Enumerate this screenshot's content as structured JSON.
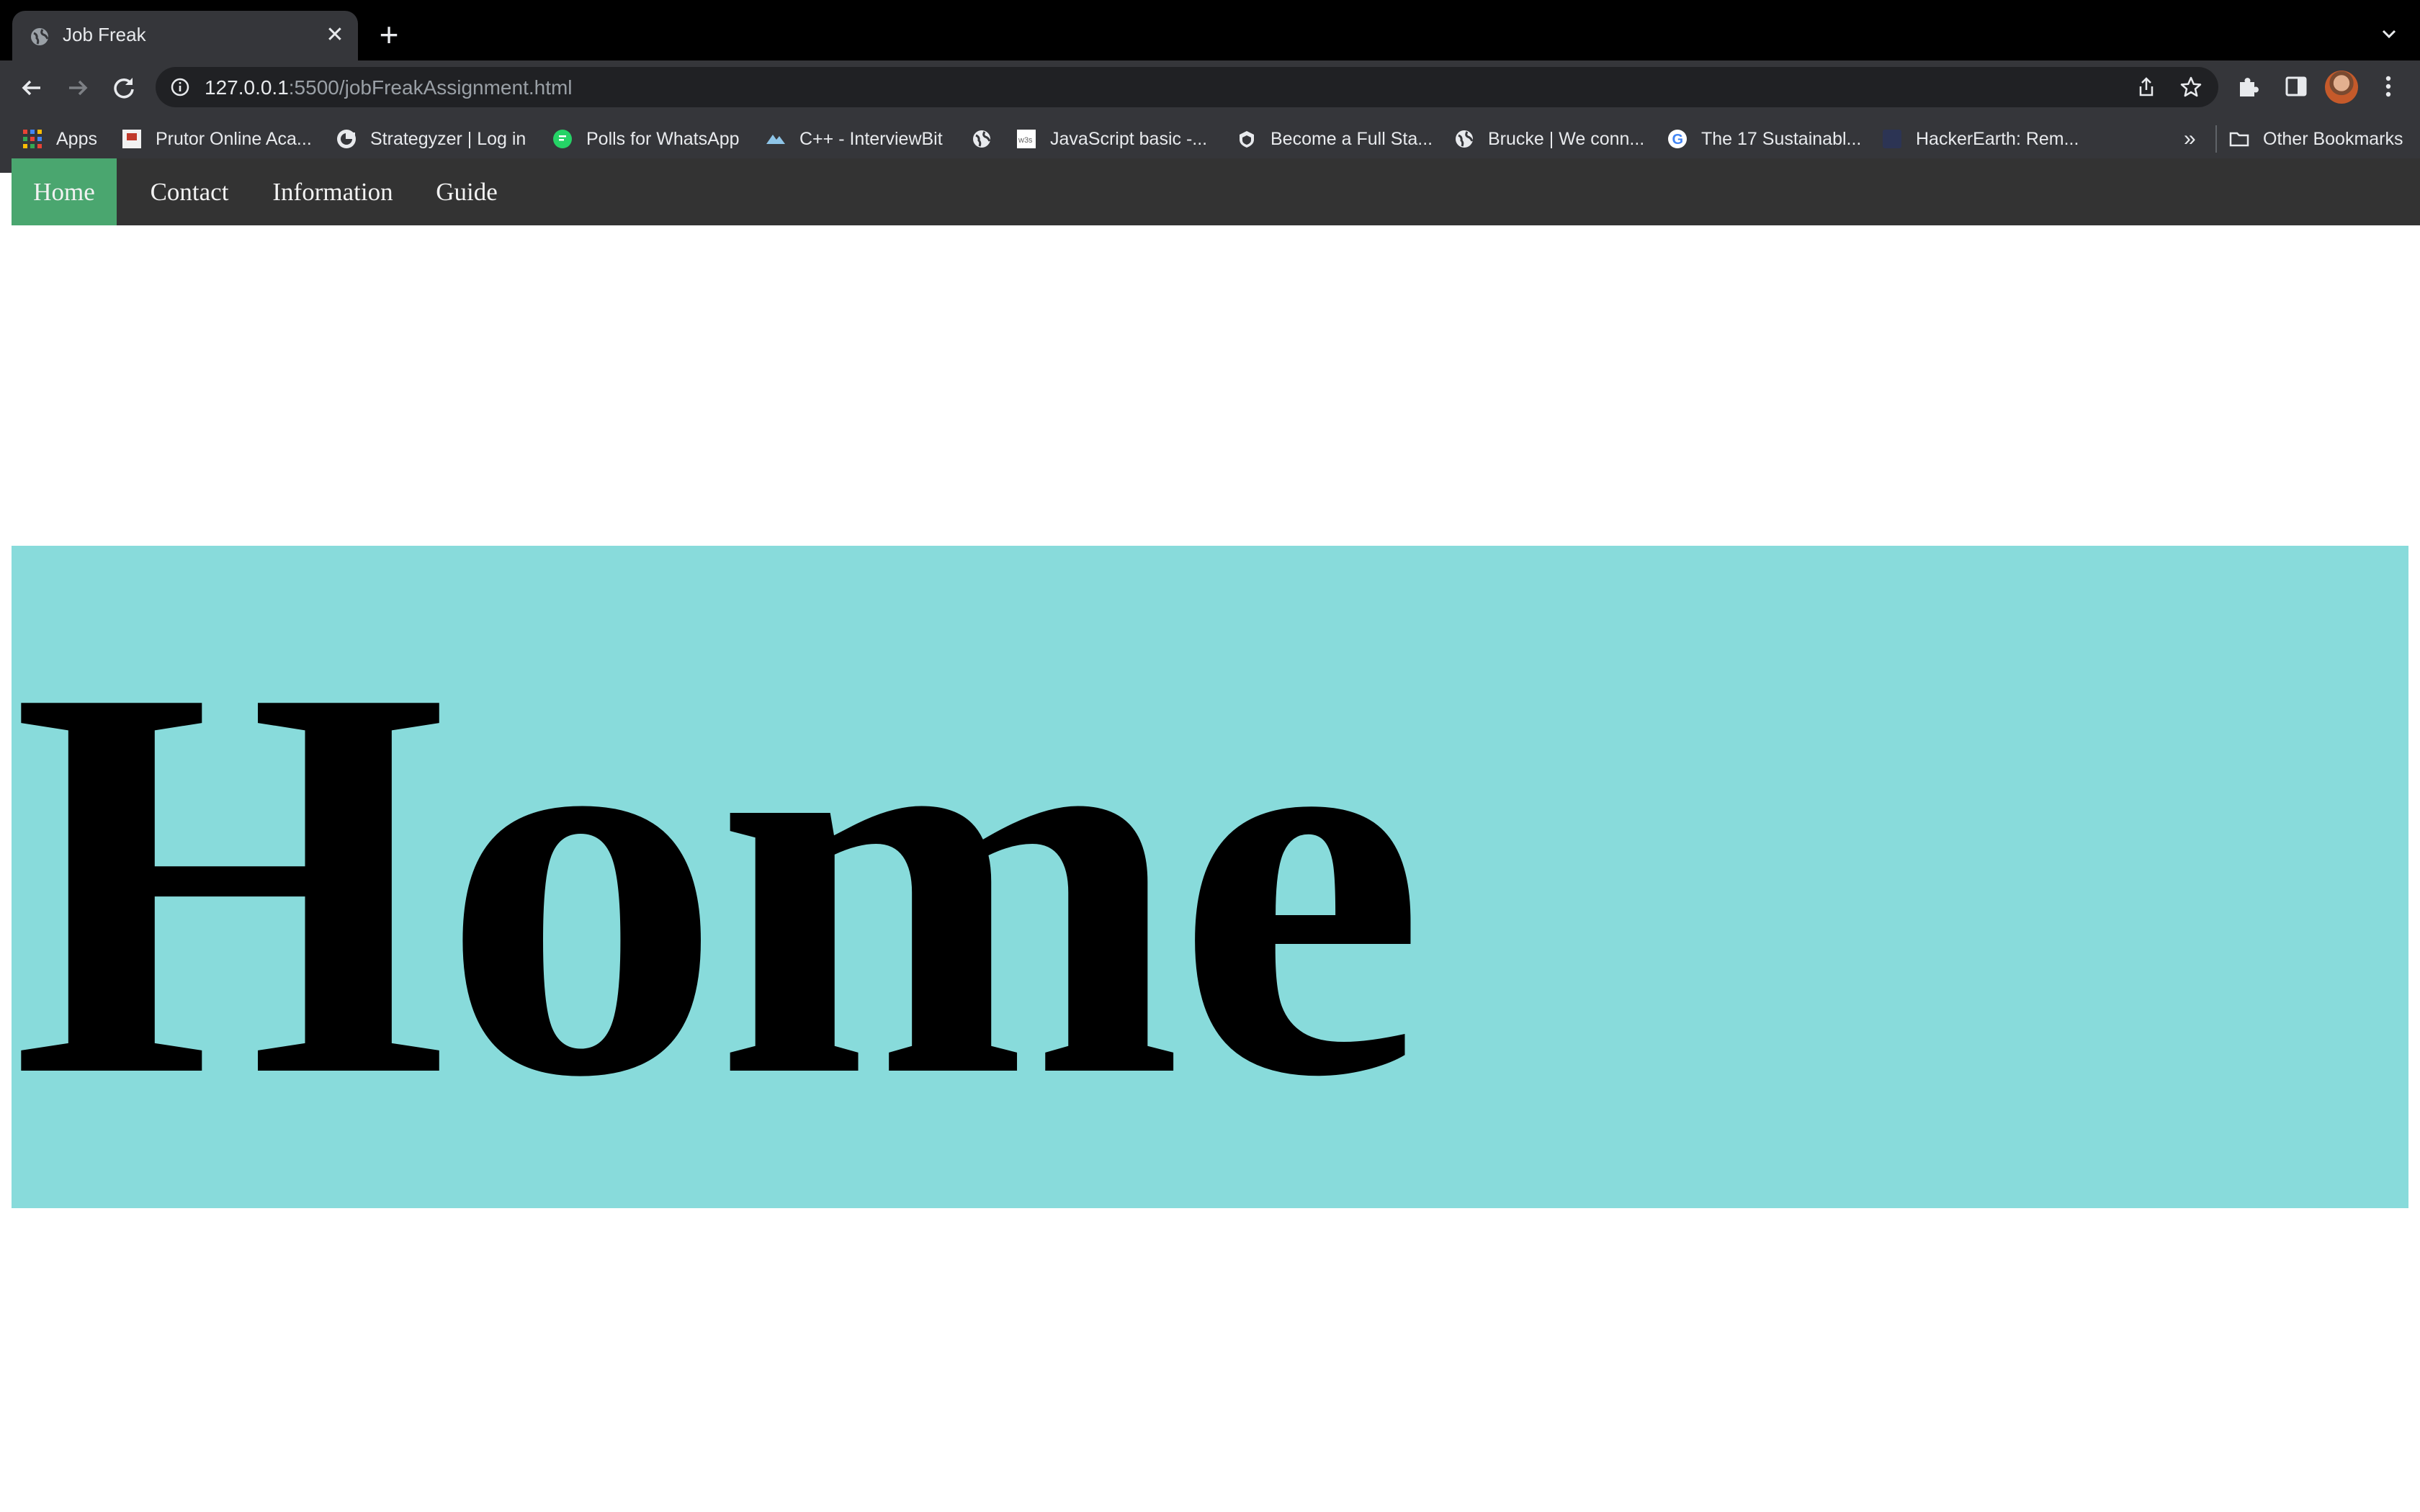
{
  "browser": {
    "tab_title": "Job Freak",
    "url_host": "127.0.0.1",
    "url_rest": ":5500/jobFreakAssignment.html",
    "bookmarks": [
      {
        "label": "Apps",
        "icon": "apps-grid-icon"
      },
      {
        "label": "Prutor Online Aca...",
        "icon": "prutor-icon"
      },
      {
        "label": "Strategyzer | Log in",
        "icon": "strategyzer-icon"
      },
      {
        "label": "Polls for WhatsApp",
        "icon": "whatsapp-icon"
      },
      {
        "label": "C++ - InterviewBit",
        "icon": "interviewbit-icon"
      },
      {
        "label": "",
        "icon": "globe-icon"
      },
      {
        "label": "JavaScript basic -...",
        "icon": "w3schools-icon"
      },
      {
        "label": "Become a Full Sta...",
        "icon": "shield-icon"
      },
      {
        "label": "Brucke | We conn...",
        "icon": "globe-icon"
      },
      {
        "label": "The 17 Sustainabl...",
        "icon": "google-icon"
      },
      {
        "label": "HackerEarth: Rem...",
        "icon": "hackerearth-icon"
      }
    ],
    "more_bookmarks": "»",
    "other_bookmarks": "Other Bookmarks"
  },
  "nav": {
    "items": [
      {
        "label": "Home",
        "active": true
      },
      {
        "label": "Contact",
        "active": false
      },
      {
        "label": "Information",
        "active": false
      },
      {
        "label": "Guide",
        "active": false
      }
    ]
  },
  "hero": {
    "title": "Home",
    "background": "#88dbdb"
  },
  "colors": {
    "nav_background": "#333333",
    "nav_active": "#4aa66f"
  }
}
